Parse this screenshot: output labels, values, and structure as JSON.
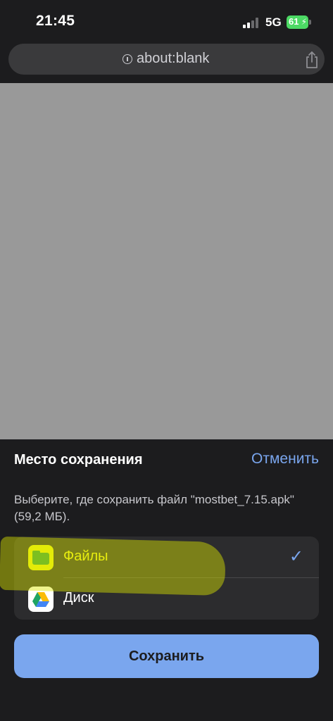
{
  "status_bar": {
    "time": "21:45",
    "network": "5G",
    "battery": "61"
  },
  "browser": {
    "url": "about:blank"
  },
  "sheet": {
    "title": "Место сохранения",
    "cancel_label": "Отменить",
    "description": "Выберите, где сохранить файл \"mostbet_7.15.apk\" (59,2 МБ).",
    "options": [
      {
        "label": "Файлы",
        "icon": "files-folder-icon",
        "selected": true
      },
      {
        "label": "Диск",
        "icon": "google-drive-icon",
        "selected": false
      }
    ],
    "save_label": "Сохранить"
  },
  "colors": {
    "accent": "#7aa6ee",
    "sheet_background": "#1c1c1e",
    "web_content": "#999999",
    "highlight": "#e9ee10"
  }
}
